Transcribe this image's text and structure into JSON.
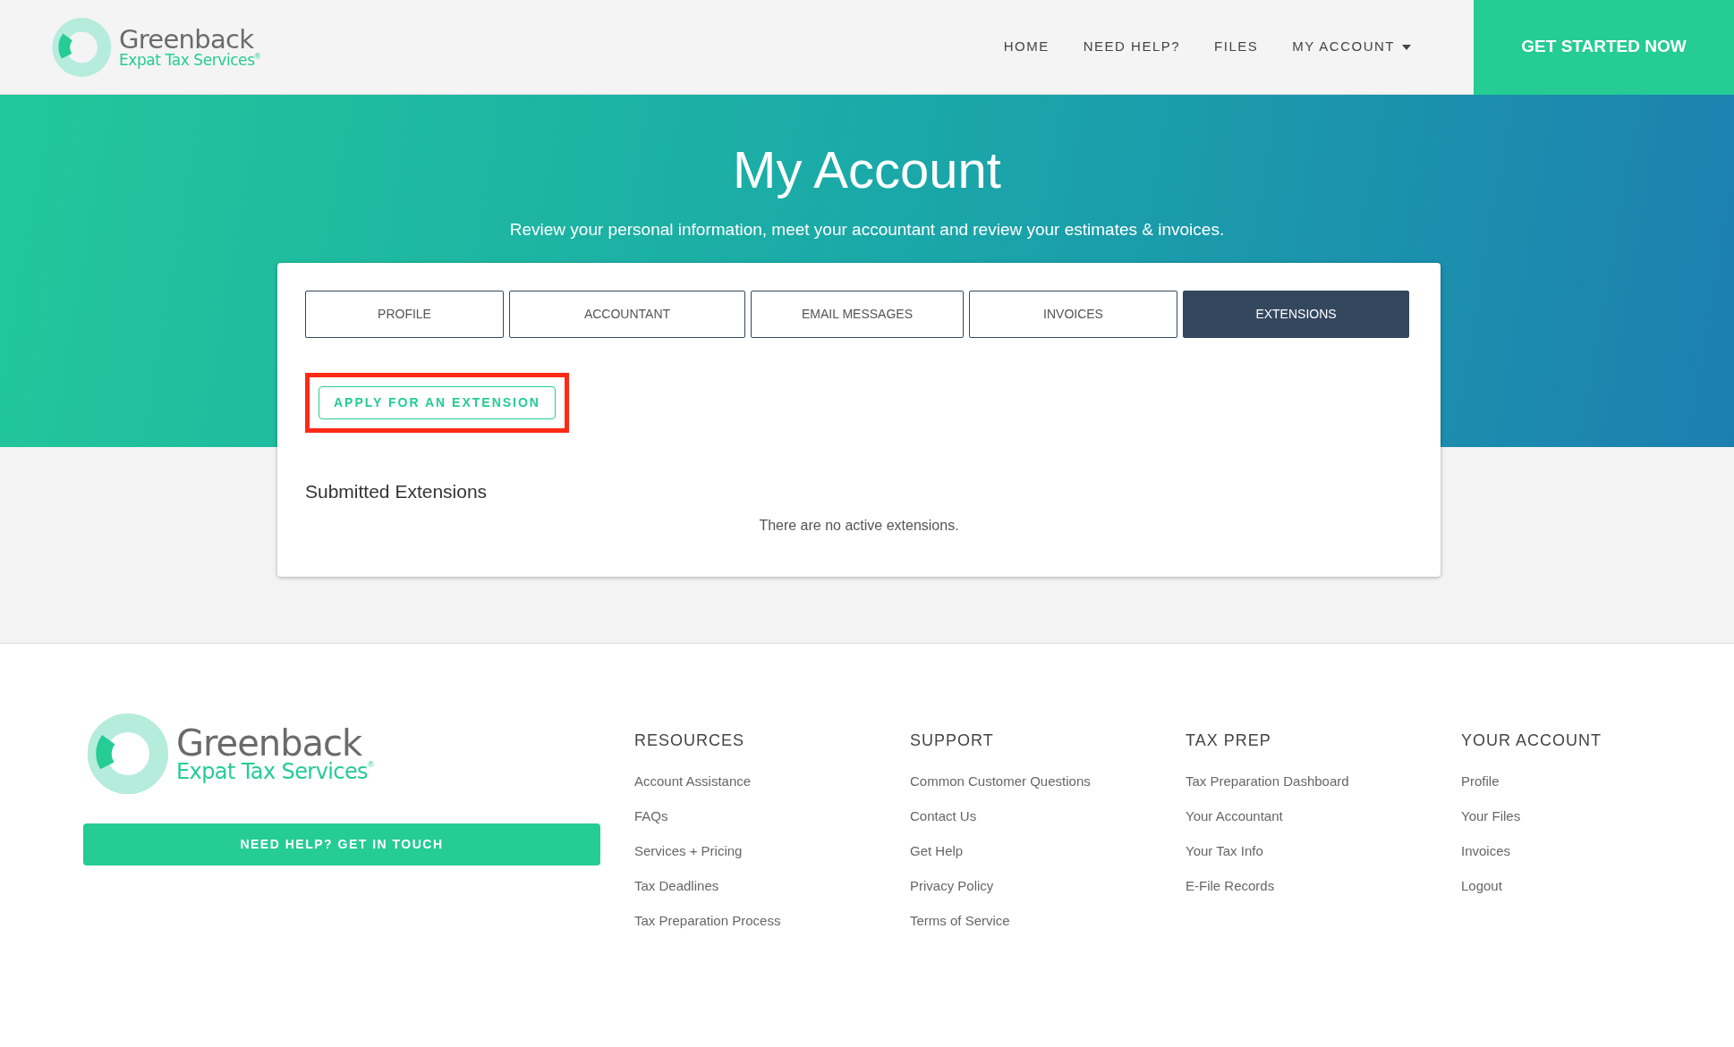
{
  "header": {
    "logo": {
      "name": "Greenback",
      "tagline": "Expat Tax Services",
      "mark": "®"
    },
    "nav": [
      {
        "label": "HOME",
        "dropdown": false
      },
      {
        "label": "NEED HELP?",
        "dropdown": false
      },
      {
        "label": "FILES",
        "dropdown": false
      },
      {
        "label": "MY ACCOUNT",
        "dropdown": true
      }
    ],
    "cta": "GET STARTED NOW"
  },
  "hero": {
    "title": "My Account",
    "subtitle": "Review your personal information, meet your accountant and review your estimates & invoices."
  },
  "tabs": [
    {
      "label": "PROFILE",
      "selected": false
    },
    {
      "label": "ACCOUNTANT",
      "selected": false
    },
    {
      "label": "EMAIL MESSAGES",
      "selected": false
    },
    {
      "label": "INVOICES",
      "selected": false
    },
    {
      "label": "EXTENSIONS",
      "selected": true
    }
  ],
  "apply_button": {
    "label": "APPLY FOR AN EXTENSION",
    "highlighted": true
  },
  "submitted": {
    "heading": "Submitted Extensions",
    "empty_message": "There are no active extensions."
  },
  "footer": {
    "logo": {
      "name": "Greenback",
      "tagline": "Expat Tax Services",
      "mark": "®"
    },
    "contact_button": "NEED HELP? GET IN TOUCH",
    "columns": [
      {
        "heading": "RESOURCES",
        "links": [
          "Account Assistance",
          "FAQs",
          "Services + Pricing",
          "Tax Deadlines",
          "Tax Preparation Process"
        ]
      },
      {
        "heading": "SUPPORT",
        "links": [
          "Common Customer Questions",
          "Contact Us",
          "Get Help",
          "Privacy Policy",
          "Terms of Service"
        ]
      },
      {
        "heading": "TAX PREP",
        "links": [
          "Tax Preparation Dashboard",
          "Your Accountant",
          "Your Tax Info",
          "E-File Records"
        ]
      },
      {
        "heading": "YOUR ACCOUNT",
        "links": [
          "Profile",
          "Your Files",
          "Invoices",
          "Logout"
        ]
      }
    ]
  }
}
